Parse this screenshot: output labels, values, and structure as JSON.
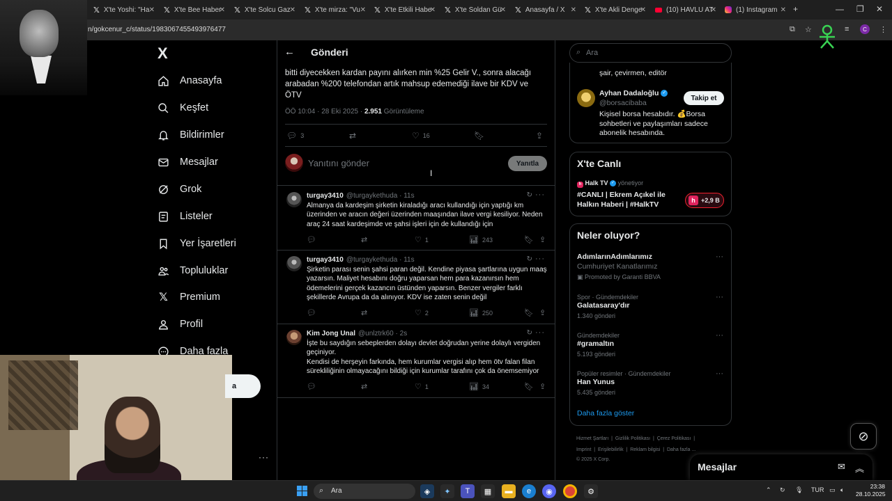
{
  "browser": {
    "tabs": [
      {
        "label": "X'te Yoshi: \"Ha",
        "favicon": "x-icon"
      },
      {
        "label": "X'te Bee Haber",
        "favicon": "x-icon"
      },
      {
        "label": "X'te Solcu Gaz",
        "favicon": "x-icon"
      },
      {
        "label": "X'te mirza: \"Vu",
        "favicon": "x-icon"
      },
      {
        "label": "X'te Etkili Habe",
        "favicon": "x-icon"
      },
      {
        "label": "X'te Soldan Gü",
        "favicon": "x-icon"
      },
      {
        "label": "Anasayfa / X",
        "favicon": "x-icon"
      },
      {
        "label": "X'te Akli Denge",
        "favicon": "x-icon"
      },
      {
        "label": "(10) HAVLU AT",
        "favicon": "youtube-icon"
      },
      {
        "label": "(1) Instagram",
        "favicon": "instagram-icon"
      }
    ],
    "url": "n/gokcenur_c/status/1983067455493976477",
    "profile_initial": "C"
  },
  "nav": {
    "logo": "X",
    "items": [
      {
        "label": "Anasayfa",
        "icon": "home-icon"
      },
      {
        "label": "Keşfet",
        "icon": "search-icon"
      },
      {
        "label": "Bildirimler",
        "icon": "bell-icon"
      },
      {
        "label": "Mesajlar",
        "icon": "mail-icon"
      },
      {
        "label": "Grok",
        "icon": "grok-icon"
      },
      {
        "label": "Listeler",
        "icon": "list-icon"
      },
      {
        "label": "Yer İşaretleri",
        "icon": "bookmark-icon"
      },
      {
        "label": "Topluluklar",
        "icon": "communities-icon"
      },
      {
        "label": "Premium",
        "icon": "x-premium-icon"
      },
      {
        "label": "Profil",
        "icon": "profile-icon"
      },
      {
        "label": "Daha fazla",
        "icon": "more-icon"
      }
    ],
    "post_button_fragment": "a"
  },
  "post": {
    "header_title": "Gönderi",
    "text": "bitti diyecekken kardan payını alırken min %25 Gelir V., sonra  alacağı arabadan %200 telefondan artık mahsup edemediği ilave bir KDV ve ÖTV",
    "time": "ÖÖ 10:04 · 28 Eki 2025 · ",
    "views": "2.951",
    "views_label": " Görüntüleme",
    "replies": "3",
    "reposts": "",
    "likes": "16",
    "reply_placeholder": "Yanıtını gönder",
    "reply_button": "Yanıtla"
  },
  "replies": [
    {
      "name": "turgay3410",
      "handle": "@turgaykethuda · 11s",
      "text": "Almanya da kardeşim şirketin kiraladığı aracı kullandığı için yaptığı km üzerinden ve aracın değeri üzerinden maaşından ilave vergi kesiliyor. Neden araç 24 saat kardeşimde ve şahsi işleri için de kullandığı için",
      "replies": "",
      "reposts": "",
      "likes": "1",
      "views": "243"
    },
    {
      "name": "turgay3410",
      "handle": "@turgaykethuda · 11s",
      "text": "Şirketin parası senin şahsi paran değil. Kendine piyasa şartlarına uygun maaş yazarsın. Maliyet hesabını doğru yaparsan hem para kazanırsın hem ödemelerini gerçek kazancın üstünden yaparsın. Benzer vergiler farklı şekillerde Avrupa da da alınıyor. KDV ise zaten senin değil",
      "replies": "",
      "reposts": "",
      "likes": "2",
      "views": "250"
    },
    {
      "name": "Kim Jong Unal",
      "handle": "@unlztrk60 · 2s",
      "text": "İşte bu saydığın sebeplerden dolayı devlet doğrudan yerine dolaylı vergiden geçiniyor.\nKendisi de herşeyin farkında, hem kurumlar vergisi alıp hem ötv falan filan sürekliliğinin olmayacağını bildiği için kurumlar tarafını çok da önemsemiyor",
      "replies": "",
      "reposts": "",
      "likes": "1",
      "views": "34"
    }
  ],
  "right": {
    "search_placeholder": "Ara",
    "suggest_bio_top": "şair, çevirmen, editör",
    "suggest": {
      "name": "Ayhan Dadaloğlu",
      "handle": "@borsacibaba",
      "bio": "Kişisel borsa hesabıdır. 💰Borsa sohbetleri ve paylaşımları sadece abonelik hesabında.",
      "follow_label": "Takip et"
    },
    "live": {
      "title": "X'te Canlı",
      "host": "Halk TV",
      "host_role": "yönetiyor",
      "stream_title": "#CANLI | Ekrem Açıkel ile Halkın Haberi | #HalkTV",
      "listeners": "+2,9 B"
    },
    "trends_title": "Neler oluyor?",
    "trends": [
      {
        "context": "",
        "name": "AdımlarınAdımlarımız",
        "sub": "Cumhuriyet Kanatlarımız",
        "meta": "Promoted by Garanti BBVA"
      },
      {
        "context": "Spor · Gündemdekiler",
        "name": "Galatasaray'dır",
        "sub": "",
        "meta": "1.340 gönderi"
      },
      {
        "context": "Gündemdekiler",
        "name": "#gramaltın",
        "sub": "",
        "meta": "5.193 gönderi"
      },
      {
        "context": "Popüler resimler · Gündemdekiler",
        "name": "Han Yunus",
        "sub": "",
        "meta": "5.435 gönderi"
      }
    ],
    "show_more": "Daha fazla göster",
    "footer": {
      "line1": [
        "Hizmet Şartları",
        "Gizlilik Politikası",
        "Çerez Politikası"
      ],
      "line2": [
        "Imprint",
        "Erişilebilirlik",
        "Reklam bilgisi",
        "Daha fazla ..."
      ],
      "copyright": "© 2025 X Corp."
    }
  },
  "dm_drawer": {
    "title": "Mesajlar"
  },
  "taskbar": {
    "search_label": "Ara",
    "lang": "TUR",
    "time": "23:38",
    "date": "28.10.2025"
  },
  "colors": {
    "accent": "#1d9bf0",
    "live": "#f4212e",
    "background": "#000000"
  }
}
